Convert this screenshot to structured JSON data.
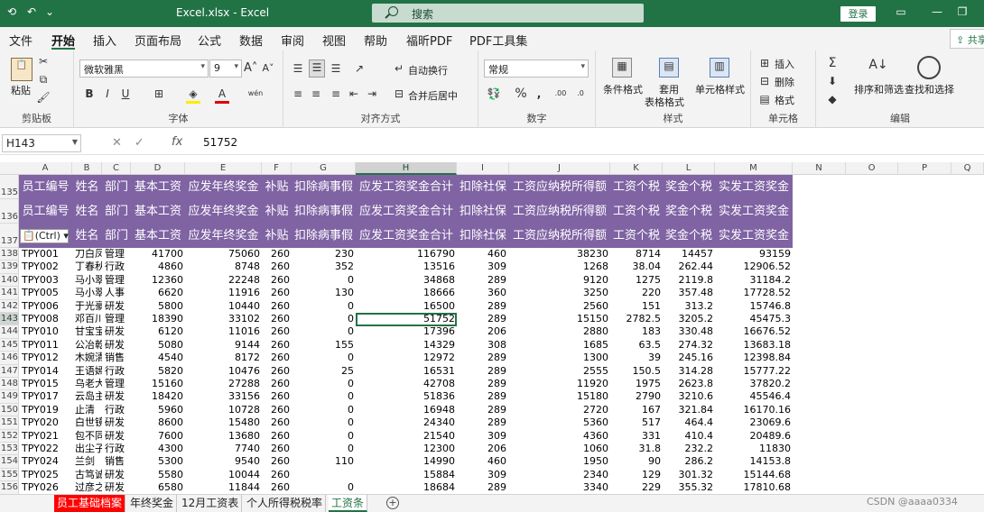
{
  "titlebar": {
    "title": "Excel.xlsx  -  Excel",
    "search_placeholder": "搜索",
    "login_label": "登录"
  },
  "tabs": [
    {
      "label": "文件"
    },
    {
      "label": "开始"
    },
    {
      "label": "插入"
    },
    {
      "label": "页面布局"
    },
    {
      "label": "公式"
    },
    {
      "label": "数据"
    },
    {
      "label": "审阅"
    },
    {
      "label": "视图"
    },
    {
      "label": "帮助"
    },
    {
      "label": "福昕PDF"
    },
    {
      "label": "PDF工具集"
    }
  ],
  "share_label": "共享",
  "ribbon": {
    "clipboard": {
      "paste": "粘贴",
      "label": "剪贴板"
    },
    "font": {
      "name": "微软雅黑",
      "size": "9",
      "label": "字体"
    },
    "alignment": {
      "wrap": "自动换行",
      "merge": "合并后居中",
      "label": "对齐方式"
    },
    "number": {
      "format": "常规",
      "label": "数字"
    },
    "styles": {
      "cond": "条件格式",
      "table_line1": "套用",
      "table_line2": "表格格式",
      "cell_styles": "单元格样式",
      "label": "样式"
    },
    "cells": {
      "insert": "插入",
      "delete": "删除",
      "format": "格式",
      "label": "单元格"
    },
    "editing": {
      "sort": "排序和筛选",
      "find": "查找和选择",
      "label": "编辑"
    }
  },
  "formula_bar": {
    "name_box": "H143",
    "fx": "fx",
    "formula": "51752"
  },
  "columns": [
    "A",
    "B",
    "C",
    "D",
    "E",
    "F",
    "G",
    "H",
    "I",
    "J",
    "K",
    "L",
    "M",
    "N",
    "O",
    "P",
    "Q"
  ],
  "header_rows": [
    "135",
    "136",
    "137"
  ],
  "headers": [
    "员工编号",
    "姓名",
    "部门",
    "基本工资",
    "应发年终奖金",
    "补贴",
    "扣除病事假",
    "应发工资奖金合计",
    "扣除社保",
    "工资应纳税所得额",
    "工资个税",
    "奖金个税",
    "实发工资奖金"
  ],
  "paste_options": "(Ctrl)",
  "rows": [
    {
      "r": "138",
      "id": "TPY001",
      "name": "刀白凤",
      "dept": "管理",
      "base": "41700",
      "bonus": "75060",
      "sub": "260",
      "ded": "230",
      "total": "116790",
      "ss": "460",
      "taxable": "38230",
      "tax": "8714",
      "btax": "14457",
      "net": "93159"
    },
    {
      "r": "139",
      "id": "TPY002",
      "name": "丁春秋",
      "dept": "行政",
      "base": "4860",
      "bonus": "8748",
      "sub": "260",
      "ded": "352",
      "total": "13516",
      "ss": "309",
      "taxable": "1268",
      "tax": "38.04",
      "btax": "262.44",
      "net": "12906.52"
    },
    {
      "r": "140",
      "id": "TPY003",
      "name": "马小翠",
      "dept": "管理",
      "base": "12360",
      "bonus": "22248",
      "sub": "260",
      "ded": "0",
      "total": "34868",
      "ss": "289",
      "taxable": "9120",
      "tax": "1275",
      "btax": "2119.8",
      "net": "31184.2"
    },
    {
      "r": "141",
      "id": "TPY005",
      "name": "马小翠",
      "dept": "人事",
      "base": "6620",
      "bonus": "11916",
      "sub": "260",
      "ded": "130",
      "total": "18666",
      "ss": "360",
      "taxable": "3250",
      "tax": "220",
      "btax": "357.48",
      "net": "17728.52"
    },
    {
      "r": "142",
      "id": "TPY006",
      "name": "于光豪",
      "dept": "研发",
      "base": "5800",
      "bonus": "10440",
      "sub": "260",
      "ded": "0",
      "total": "16500",
      "ss": "289",
      "taxable": "2560",
      "tax": "151",
      "btax": "313.2",
      "net": "15746.8"
    },
    {
      "r": "143",
      "id": "TPY008",
      "name": "邓百川",
      "dept": "管理",
      "base": "18390",
      "bonus": "33102",
      "sub": "260",
      "ded": "0",
      "total": "51752",
      "ss": "289",
      "taxable": "15150",
      "tax": "2782.5",
      "btax": "3205.2",
      "net": "45475.3"
    },
    {
      "r": "144",
      "id": "TPY010",
      "name": "甘宝宝",
      "dept": "研发",
      "base": "6120",
      "bonus": "11016",
      "sub": "260",
      "ded": "0",
      "total": "17396",
      "ss": "206",
      "taxable": "2880",
      "tax": "183",
      "btax": "330.48",
      "net": "16676.52"
    },
    {
      "r": "145",
      "id": "TPY011",
      "name": "公冶乾",
      "dept": "研发",
      "base": "5080",
      "bonus": "9144",
      "sub": "260",
      "ded": "155",
      "total": "14329",
      "ss": "308",
      "taxable": "1685",
      "tax": "63.5",
      "btax": "274.32",
      "net": "13683.18"
    },
    {
      "r": "146",
      "id": "TPY012",
      "name": "木婉清",
      "dept": "销售",
      "base": "4540",
      "bonus": "8172",
      "sub": "260",
      "ded": "0",
      "total": "12972",
      "ss": "289",
      "taxable": "1300",
      "tax": "39",
      "btax": "245.16",
      "net": "12398.84"
    },
    {
      "r": "147",
      "id": "TPY014",
      "name": "王语嫣",
      "dept": "行政",
      "base": "5820",
      "bonus": "10476",
      "sub": "260",
      "ded": "25",
      "total": "16531",
      "ss": "289",
      "taxable": "2555",
      "tax": "150.5",
      "btax": "314.28",
      "net": "15777.22"
    },
    {
      "r": "148",
      "id": "TPY015",
      "name": "乌老大",
      "dept": "管理",
      "base": "15160",
      "bonus": "27288",
      "sub": "260",
      "ded": "0",
      "total": "42708",
      "ss": "289",
      "taxable": "11920",
      "tax": "1975",
      "btax": "2623.8",
      "net": "37820.2"
    },
    {
      "r": "149",
      "id": "TPY017",
      "name": "云岛主",
      "dept": "研发",
      "base": "18420",
      "bonus": "33156",
      "sub": "260",
      "ded": "0",
      "total": "51836",
      "ss": "289",
      "taxable": "15180",
      "tax": "2790",
      "btax": "3210.6",
      "net": "45546.4"
    },
    {
      "r": "150",
      "id": "TPY019",
      "name": "止清",
      "dept": "行政",
      "base": "5960",
      "bonus": "10728",
      "sub": "260",
      "ded": "0",
      "total": "16948",
      "ss": "289",
      "taxable": "2720",
      "tax": "167",
      "btax": "321.84",
      "net": "16170.16"
    },
    {
      "r": "151",
      "id": "TPY020",
      "name": "白世镜",
      "dept": "研发",
      "base": "8600",
      "bonus": "15480",
      "sub": "260",
      "ded": "0",
      "total": "24340",
      "ss": "289",
      "taxable": "5360",
      "tax": "517",
      "btax": "464.4",
      "net": "23069.6"
    },
    {
      "r": "152",
      "id": "TPY021",
      "name": "包不同",
      "dept": "研发",
      "base": "7600",
      "bonus": "13680",
      "sub": "260",
      "ded": "0",
      "total": "21540",
      "ss": "309",
      "taxable": "4360",
      "tax": "331",
      "btax": "410.4",
      "net": "20489.6"
    },
    {
      "r": "153",
      "id": "TPY022",
      "name": "出尘子",
      "dept": "行政",
      "base": "4300",
      "bonus": "7740",
      "sub": "260",
      "ded": "0",
      "total": "12300",
      "ss": "206",
      "taxable": "1060",
      "tax": "31.8",
      "btax": "232.2",
      "net": "11830"
    },
    {
      "r": "154",
      "id": "TPY024",
      "name": "兰剑",
      "dept": "销售",
      "base": "5300",
      "bonus": "9540",
      "sub": "260",
      "ded": "110",
      "total": "14990",
      "ss": "460",
      "taxable": "1950",
      "tax": "90",
      "btax": "286.2",
      "net": "14153.8"
    },
    {
      "r": "155",
      "id": "TPY025",
      "name": "古笃诚",
      "dept": "研发",
      "base": "5580",
      "bonus": "10044",
      "sub": "260",
      "ded": "",
      "total": "15884",
      "ss": "309",
      "taxable": "2340",
      "tax": "129",
      "btax": "301.32",
      "net": "15144.68"
    },
    {
      "r": "156",
      "id": "TPY026",
      "name": "过彦之",
      "dept": "研发",
      "base": "6580",
      "bonus": "11844",
      "sub": "260",
      "ded": "0",
      "total": "18684",
      "ss": "289",
      "taxable": "3340",
      "tax": "229",
      "btax": "355.32",
      "net": "17810.68"
    }
  ],
  "sheets": [
    {
      "label": "员工基础档案"
    },
    {
      "label": "年终奖金"
    },
    {
      "label": "12月工资表"
    },
    {
      "label": "个人所得税税率"
    },
    {
      "label": "工资条"
    }
  ],
  "watermark": "CSDN @aaaa0334",
  "colors": {
    "header_fill": "#7f63a3",
    "excel_green": "#217346"
  }
}
